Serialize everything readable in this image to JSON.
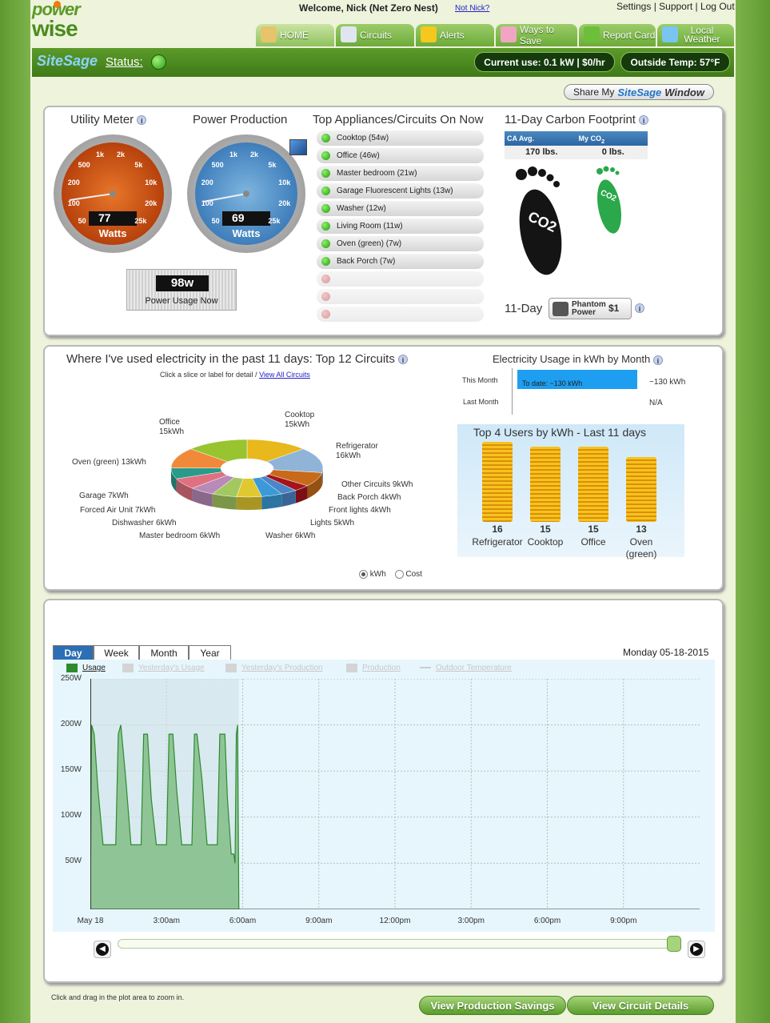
{
  "header": {
    "logo_line1": "power",
    "logo_line2": "wise",
    "welcome": "Welcome, Nick (Net Zero Nest)",
    "not_user_link": "Not Nick?",
    "top_links": "Settings | Support | Log Out",
    "tabs": [
      {
        "label": "HOME",
        "icon": "house-icon"
      },
      {
        "label": "Circuits",
        "icon": "circuit-icon"
      },
      {
        "label": "Alerts",
        "icon": "warning-icon"
      },
      {
        "label": "Ways to Save",
        "icon": "piggy-bank-icon"
      },
      {
        "label": "Report Card",
        "icon": "leaf-icon"
      },
      {
        "label": "Local Weather",
        "icon": "weather-icon"
      }
    ]
  },
  "statusbar": {
    "brand": "SiteSage",
    "status_label": "Status:",
    "current_use": "Current use: 0.1 kW | $0/hr",
    "outside_temp": "Outside Temp: 57°F"
  },
  "share_button": {
    "prefix": "Share My",
    "brand": "SiteSage",
    "suffix": "Window"
  },
  "top_panel": {
    "utility_meter": {
      "title": "Utility Meter",
      "value": "77",
      "unit": "Watts",
      "ticks": [
        "50",
        "100",
        "200",
        "500",
        "1k",
        "2k",
        "5k",
        "10k",
        "20k",
        "25k"
      ]
    },
    "power_production": {
      "title": "Power Production",
      "value": "69",
      "unit": "Watts",
      "ticks": [
        "50",
        "100",
        "200",
        "500",
        "1k",
        "2k",
        "5k",
        "10k",
        "20k",
        "25k"
      ]
    },
    "power_usage_now": {
      "value": "98w",
      "label": "Power Usage Now"
    },
    "appliances_title": "Top Appliances/Circuits On Now",
    "appliances": [
      "Cooktop (54w)",
      "Office (46w)",
      "Master bedroom (21w)",
      "Garage Fluorescent Lights (13w)",
      "Washer (12w)",
      "Living Room (11w)",
      "Oven (green) (7w)",
      "Back Porch (7w)",
      "",
      "",
      ""
    ],
    "carbon": {
      "title": "11-Day Carbon Footprint",
      "col1": "CA Avg.",
      "col2": "My CO",
      "col2_sub": "2",
      "val1": "170 lbs.",
      "val2": "0 lbs.",
      "footprint_text": "CO2",
      "eleven_day": "11-Day",
      "phantom_label": "Phantom Power",
      "phantom_value": "$1"
    }
  },
  "middle_panel": {
    "pie_title": "Where I've used electricity in the past 11 days: Top 12 Circuits",
    "pie_subtitle": "Click a slice or label for detail /",
    "view_all": "View All Circuits",
    "monthly_title": "Electricity Usage in kWh by Month",
    "this_month": "This Month",
    "last_month": "Last Month",
    "to_date": "To date: ~130 kWh",
    "this_value": "~130 kWh",
    "last_value": "N/A",
    "top4_title": "Top 4 Users by kWh - Last 11 days",
    "top4": [
      {
        "value": "16",
        "name": "Refrigerator"
      },
      {
        "value": "15",
        "name": "Cooktop"
      },
      {
        "value": "15",
        "name": "Office"
      },
      {
        "value": "13",
        "name": "Oven (green)"
      }
    ],
    "unit_kwh": "kWh",
    "unit_cost": "Cost",
    "unit_selected": "kWh"
  },
  "bottom_panel": {
    "tabs": [
      "Day",
      "Week",
      "Month",
      "Year"
    ],
    "active_tab": "Day",
    "date": "Monday 05-18-2015",
    "legend": [
      "Usage",
      "Yesterday's Usage",
      "Yesterday's Production",
      "Production",
      "Outdoor Temperature"
    ],
    "hint": "Click and drag in the plot area to zoom in.",
    "btn_production": "View Production Savings",
    "btn_circuit": "View Circuit Details"
  },
  "colors": {
    "brand_green": "#5a9a26",
    "usage_green": "#2e8a2e",
    "sitesage_blue": "#1e73c8"
  },
  "chart_data": [
    {
      "type": "pie",
      "title": "Where I've used electricity in the past 11 days: Top 12 Circuits",
      "categories": [
        "Cooktop",
        "Refrigerator",
        "Other Circuits",
        "Back Porch",
        "Front lights",
        "Lights",
        "Washer",
        "Master bedroom",
        "Dishwasher",
        "Forced Air Unit",
        "Garage",
        "Oven (green)",
        "Office"
      ],
      "labels": [
        "Cooktop 15kWh",
        "Refrigerator 16kWh",
        "Other Circuits 9kWh",
        "Back Porch 4kWh",
        "Front lights 4kWh",
        "Lights 5kWh",
        "Washer 6kWh",
        "Master bedroom 6kWh",
        "Dishwasher 6kWh",
        "Forced Air Unit 7kWh",
        "Garage 7kWh",
        "Oven (green) 13kWh",
        "Office 15kWh"
      ],
      "values": [
        15,
        16,
        9,
        4,
        4,
        5,
        6,
        6,
        6,
        7,
        7,
        13,
        15
      ],
      "colors": [
        "#e8b81c",
        "#8fb4d8",
        "#c76a1a",
        "#a3141c",
        "#4a86c8",
        "#3a9ad8",
        "#e0c830",
        "#a4c860",
        "#b88ab8",
        "#e07080",
        "#2a9a8a",
        "#f08a3a",
        "#98c430"
      ]
    },
    {
      "type": "bar",
      "title": "Electricity Usage in kWh by Month",
      "categories": [
        "This Month",
        "Last Month"
      ],
      "values": [
        130,
        null
      ]
    },
    {
      "type": "bar",
      "title": "Top 4 Users by kWh - Last 11 days",
      "categories": [
        "Refrigerator",
        "Cooktop",
        "Office",
        "Oven (green)"
      ],
      "values": [
        16,
        15,
        15,
        13
      ]
    },
    {
      "type": "area",
      "title": "",
      "series_name": "Usage",
      "xlabels": [
        "May 18",
        "3:00am",
        "6:00am",
        "9:00am",
        "12:00pm",
        "3:00pm",
        "6:00pm",
        "9:00pm"
      ],
      "ylabels": [
        "250W",
        "200W",
        "150W",
        "100W",
        "50W"
      ],
      "ylim": [
        0,
        250
      ],
      "xlim_hours": [
        0,
        24
      ],
      "points": [
        [
          0,
          0
        ],
        [
          0.05,
          200
        ],
        [
          0.15,
          190
        ],
        [
          0.3,
          130
        ],
        [
          0.4,
          100
        ],
        [
          0.5,
          70
        ],
        [
          1.0,
          70
        ],
        [
          1.1,
          190
        ],
        [
          1.2,
          200
        ],
        [
          1.4,
          140
        ],
        [
          1.6,
          70
        ],
        [
          2.0,
          70
        ],
        [
          2.1,
          190
        ],
        [
          2.25,
          190
        ],
        [
          2.4,
          120
        ],
        [
          2.6,
          70
        ],
        [
          3.0,
          70
        ],
        [
          3.1,
          190
        ],
        [
          3.25,
          190
        ],
        [
          3.4,
          130
        ],
        [
          3.6,
          70
        ],
        [
          4.0,
          70
        ],
        [
          4.1,
          190
        ],
        [
          4.2,
          190
        ],
        [
          4.4,
          140
        ],
        [
          4.6,
          70
        ],
        [
          5.0,
          70
        ],
        [
          5.1,
          190
        ],
        [
          5.3,
          190
        ],
        [
          5.4,
          120
        ],
        [
          5.55,
          60
        ],
        [
          5.65,
          60
        ],
        [
          5.7,
          50
        ],
        [
          5.75,
          190
        ],
        [
          5.8,
          200
        ],
        [
          5.85,
          0
        ]
      ],
      "grid": true
    }
  ]
}
